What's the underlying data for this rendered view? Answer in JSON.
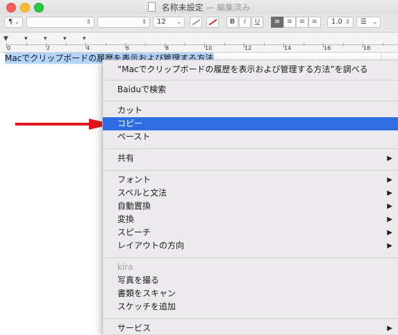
{
  "window": {
    "title": "名称未設定",
    "status": "— 編集済み"
  },
  "toolbar": {
    "paragraph_style": "¶",
    "font_family": "",
    "font_style": "",
    "font_size": "12",
    "bold": "B",
    "italic": "I",
    "underline": "U",
    "line_spacing": "1.0",
    "list_style": "☰",
    "colors": {
      "text_color": "#e52222",
      "accent": "#2e6ce2"
    }
  },
  "ruler": {
    "labels": [
      "0",
      "2",
      "4",
      "6",
      "8",
      "10",
      "12",
      "14",
      "16",
      "18"
    ]
  },
  "document": {
    "selected_text": "Macでクリップボードの履歴を表示および管理する方法"
  },
  "context_menu": {
    "lookup": "“Macでクリップボードの履歴を表示および管理する方法”を調べる",
    "search": "Baiduで検索",
    "cut": "カット",
    "copy": "コピー",
    "paste": "ペースト",
    "share": "共有",
    "font": "フォント",
    "spelling": "スペルと文法",
    "substitutions": "自動置換",
    "transformations": "変換",
    "speech": "スピーチ",
    "layout_direction": "レイアウトの方向",
    "device_header": "kira",
    "take_photo": "写真を撮る",
    "scan_documents": "書類をスキャン",
    "add_sketch": "スケッチを追加",
    "services": "サービス"
  }
}
